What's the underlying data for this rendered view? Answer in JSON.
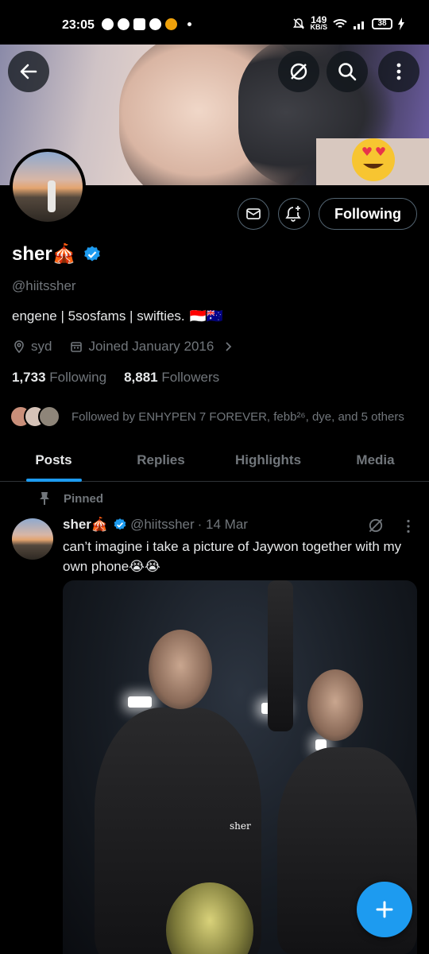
{
  "status_bar": {
    "time": "23:05",
    "speed_value": "149",
    "speed_unit": "KB/S",
    "battery": "38"
  },
  "profile": {
    "name": "sher🎪",
    "handle": "@hiitssher",
    "bio": "engene | 5sosfams | swifties.",
    "bio_flags": "🇮🇩🇦🇺",
    "location": "syd",
    "joined": "Joined January 2016",
    "following_count": "1,733",
    "following_label": "Following",
    "followers_count": "8,881",
    "followers_label": "Followers",
    "followed_by": "Followed by ENHYPEN 7 FOREVER, febb²⁶, dye, and 5 others",
    "follow_button": "Following",
    "verified_color": "#1d9bf0"
  },
  "tabs": [
    {
      "label": "Posts",
      "active": true
    },
    {
      "label": "Replies",
      "active": false
    },
    {
      "label": "Highlights",
      "active": false
    },
    {
      "label": "Media",
      "active": false
    }
  ],
  "post": {
    "pinned_label": "Pinned",
    "author": "sher🎪",
    "handle": "@hiitssher",
    "date": "· 14 Mar",
    "text": "can’t imagine i take a picture of Jaywon together with my own phone😭😭",
    "watermark": "sher"
  },
  "icons": [
    "back-arrow-icon",
    "grok-icon",
    "search-icon",
    "more-icon",
    "mail-icon",
    "bell-plus-icon",
    "location-icon",
    "calendar-icon",
    "chevron-right-icon",
    "pin-icon",
    "verified-icon",
    "plus-icon"
  ],
  "colors": {
    "accent": "#1d9bf0",
    "background": "#000000",
    "muted": "#71767b"
  }
}
